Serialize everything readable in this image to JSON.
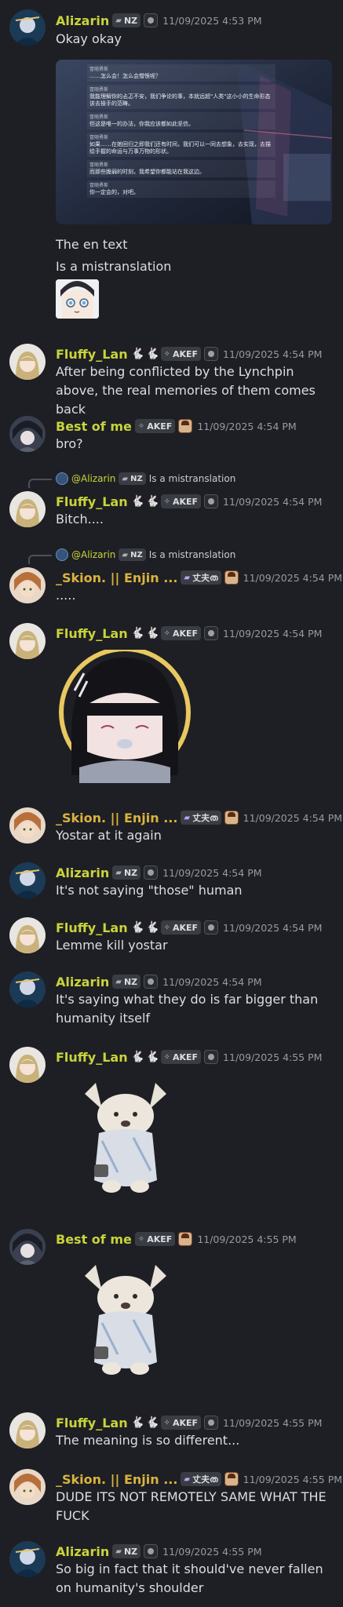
{
  "tags": {
    "nz": "NZ",
    "akef": "AKEF",
    "cn": "丈夫ത"
  },
  "messages": [
    {
      "user": "Alizarin",
      "time": "11/09/2025 4:53 PM",
      "lines": [
        "Okay okay"
      ]
    },
    {
      "screenshot": {
        "blocks": [
          {
            "speaker": "冒随勇斯",
            "text": "……怎么会！怎么会憎恨呢？"
          },
          {
            "speaker": "冒随勇斯",
            "text": "我能理解你的忐忑不安，我们争论的事，本就远超\"人类\"这小小的生命形态该去操手的范畴。"
          },
          {
            "speaker": "冒随勇斯",
            "text": "但这是唯一的办法，你我应该都如此坚信。"
          },
          {
            "speaker": "冒随勇斯",
            "text": "如果……在她回归之即我们还有时间，我们可以一同去想象，去实现，去描绘手握的命运与万事万物的形状。"
          },
          {
            "speaker": "冒随勇斯",
            "text": "而那些脆弱的时刻，我希望你都能站在我这边。"
          },
          {
            "speaker": "冒随勇斯",
            "text": "你一定会的，对吧。"
          }
        ]
      }
    },
    {
      "lines2": [
        "The en text",
        "Is a mistranslation"
      ]
    },
    {
      "user": "Fluffy_Lan",
      "time": "11/09/2025 4:54 PM",
      "lines": [
        "After being conflicted by the Lynchpin above, the real memories of them comes back"
      ]
    },
    {
      "user": "Best of me",
      "time": "11/09/2025 4:54 PM",
      "lines": [
        "bro?"
      ]
    },
    {
      "reply": {
        "name": "@Alizarin",
        "text": "Is a mistranslation"
      },
      "user": "Fluffy_Lan",
      "time": "11/09/2025 4:54 PM",
      "lines": [
        "Bitch...."
      ]
    },
    {
      "reply": {
        "name": "@Alizarin",
        "text": "Is a mistranslation"
      },
      "user": "_Skion. || Enjin ...",
      "time": "11/09/2025 4:54 PM",
      "lines": [
        "....."
      ]
    },
    {
      "user": "Fluffy_Lan",
      "time": "11/09/2025 4:54 PM"
    },
    {
      "user": "_Skion. || Enjin ...",
      "time": "11/09/2025 4:54 PM",
      "lines": [
        "Yostar at it again"
      ]
    },
    {
      "user": "Alizarin",
      "time": "11/09/2025 4:54 PM",
      "lines": [
        "It's not saying \"those\" human"
      ]
    },
    {
      "user": "Fluffy_Lan",
      "time": "11/09/2025 4:54 PM",
      "lines": [
        "Lemme kill yostar"
      ]
    },
    {
      "user": "Alizarin",
      "time": "11/09/2025 4:54 PM",
      "lines": [
        "It's saying what they do is far bigger than humanity itself"
      ]
    },
    {
      "user": "Fluffy_Lan",
      "time": "11/09/2025 4:55 PM"
    },
    {
      "user": "Best of me",
      "time": "11/09/2025 4:55 PM"
    },
    {
      "user": "Fluffy_Lan",
      "time": "11/09/2025 4:55 PM",
      "lines": [
        "The meaning is so different..."
      ]
    },
    {
      "user": "_Skion. || Enjin ...",
      "time": "11/09/2025 4:55 PM",
      "lines": [
        "DUDE ITS NOT REMOTELY SAME WHAT THE FUCK"
      ]
    },
    {
      "user": "Alizarin",
      "time": "11/09/2025 4:55 PM",
      "lines": [
        "So big in fact that it should've never fallen on humanity's shoulder"
      ]
    }
  ]
}
